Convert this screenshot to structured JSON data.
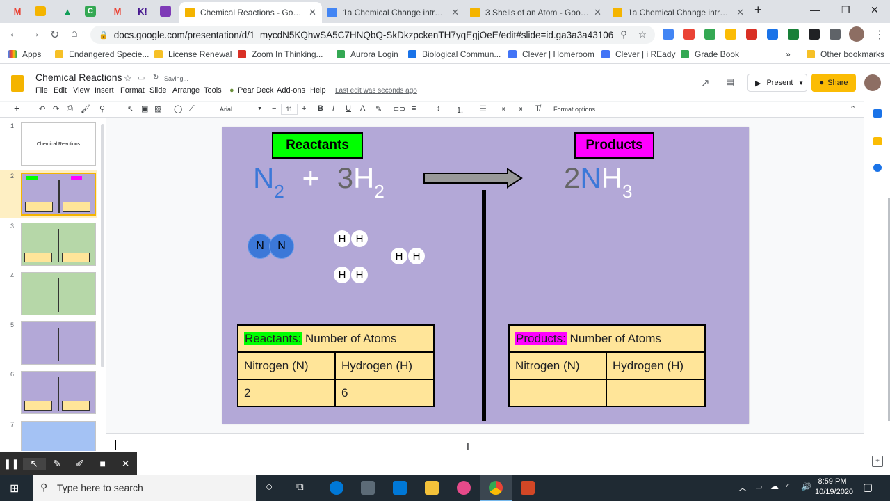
{
  "browser": {
    "tabs": [
      {
        "label": "Chemical Reactions - Google",
        "active": true
      },
      {
        "label": "1a Chemical Change intro m",
        "active": false
      },
      {
        "label": "3 Shells of an Atom - Google",
        "active": false
      },
      {
        "label": "1a Chemical Change intro 20",
        "active": false
      }
    ],
    "url": "docs.google.com/presentation/d/1_mycdN5KQhwSA5C7HNQbQ-SkDkzpckenTH7yqEgjOeE/edit#slide=id.ga3a3a43106_...",
    "bookmarks": [
      "Apps",
      "Endangered Specie...",
      "License Renewal",
      "Zoom In Thinking...",
      "Aurora Login",
      "Biological Commun...",
      "Clever | Homeroom",
      "Clever | i REady",
      "Grade Book"
    ],
    "other_bookmarks": "Other bookmarks"
  },
  "slides": {
    "title": "Chemical Reactions",
    "saving": "Saving...",
    "menus": [
      "File",
      "Edit",
      "View",
      "Insert",
      "Format",
      "Slide",
      "Arrange",
      "Tools",
      "Pear Deck",
      "Add-ons",
      "Help"
    ],
    "last_edit": "Last edit was seconds ago",
    "present": "Present",
    "share": "Share",
    "toolbar": {
      "font": "Arial",
      "size": "11",
      "format_options": "Format options"
    },
    "thumbnails": [
      {
        "num": "1",
        "label": "Chemical Reactions",
        "color": "#ffffff"
      },
      {
        "num": "2",
        "color": "#b3a8d7"
      },
      {
        "num": "3",
        "color": "#b6d7a8"
      },
      {
        "num": "4",
        "color": "#b6d7a8"
      },
      {
        "num": "5",
        "color": "#b3a8d7"
      },
      {
        "num": "6",
        "color": "#b3a8d7"
      },
      {
        "num": "7",
        "color": "#a4c2f4"
      }
    ]
  },
  "slide": {
    "reactants_label": "Reactants",
    "products_label": "Products",
    "eq": {
      "n": "N",
      "n_sub": "2",
      "plus": "+",
      "h_coef": "3",
      "h": "H",
      "h_sub": "2",
      "p_coef": "2",
      "p_n": "N",
      "p_h": "H",
      "p_sub": "3"
    },
    "atoms": {
      "n": "N",
      "h": "H"
    },
    "reactants_table": {
      "head_hl": "Reactants:",
      "head": " Number of Atoms",
      "col1": "Nitrogen (N)",
      "col2": "Hydrogen (H)",
      "val1": "2",
      "val2": "6"
    },
    "products_table": {
      "head_hl": "Products:",
      "head": " Number of Atoms",
      "col1": "Nitrogen (N)",
      "col2": "Hydrogen (H)",
      "val1": "",
      "val2": ""
    }
  },
  "taskbar": {
    "search_placeholder": "Type here to search",
    "time": "8:59 PM",
    "date": "10/19/2020"
  }
}
